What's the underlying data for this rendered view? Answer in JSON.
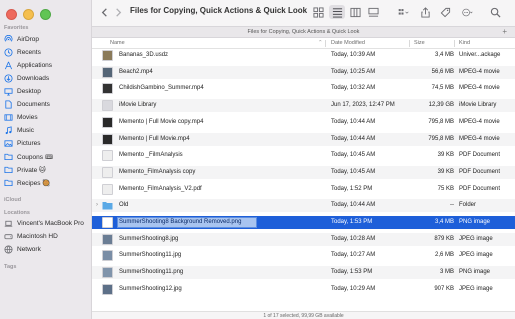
{
  "window": {
    "title": "Files for Copying, Quick Actions & Quick Look"
  },
  "tab": {
    "label": "Files for Copying, Quick Actions & Quick Look",
    "plus": "+"
  },
  "sidebar": {
    "favorites_heading": "Favorites",
    "favorites": [
      {
        "label": "AirDrop",
        "icon": "airdrop-icon"
      },
      {
        "label": "Recents",
        "icon": "clock-icon"
      },
      {
        "label": "Applications",
        "icon": "applications-icon"
      },
      {
        "label": "Downloads",
        "icon": "download-icon"
      },
      {
        "label": "Desktop",
        "icon": "desktop-icon"
      },
      {
        "label": "Documents",
        "icon": "document-icon"
      },
      {
        "label": "Movies",
        "icon": "film-icon"
      },
      {
        "label": "Music",
        "icon": "music-icon"
      },
      {
        "label": "Pictures",
        "icon": "picture-icon"
      },
      {
        "label": "Coupons 🎟",
        "icon": "folder-icon"
      },
      {
        "label": "Private 🐱",
        "icon": "folder-icon"
      },
      {
        "label": "Recipes 🥘",
        "icon": "folder-icon"
      }
    ],
    "icloud_heading": "iCloud",
    "locations_heading": "Locations",
    "locations": [
      {
        "label": "Vincent's MacBook Pro",
        "icon": "laptop-icon"
      },
      {
        "label": "Macintosh HD",
        "icon": "disk-icon"
      },
      {
        "label": "Network",
        "icon": "globe-icon"
      }
    ],
    "tags_heading": "Tags"
  },
  "columns": {
    "name": "Name",
    "date": "Date Modified",
    "size": "Size",
    "kind": "Kind"
  },
  "files": [
    {
      "name": "Bananas_3D.usdz",
      "date": "Today, 10:39 AM",
      "size": "3,4 MB",
      "kind": "Univer...ackage",
      "thumb": "#8a7a5a",
      "folder": false
    },
    {
      "name": "Beach2.mp4",
      "date": "Today, 10:25 AM",
      "size": "56,6 MB",
      "kind": "MPEG-4 movie",
      "thumb": "#556677",
      "folder": false
    },
    {
      "name": "ChildishGambino_Summer.mp4",
      "date": "Today, 10:32 AM",
      "size": "74,5 MB",
      "kind": "MPEG-4 movie",
      "thumb": "#333333",
      "folder": false
    },
    {
      "name": "iMovie Library",
      "date": "Jun 17, 2023, 12:47 PM",
      "size": "12,39 GB",
      "kind": "iMovie Library",
      "thumb": "#d9d9de",
      "folder": false
    },
    {
      "name": "Memento | Full Movie copy.mp4",
      "date": "Today, 10:44 AM",
      "size": "795,8 MB",
      "kind": "MPEG-4 movie",
      "thumb": "#2a2a2a",
      "folder": false
    },
    {
      "name": "Memento | Full Movie.mp4",
      "date": "Today, 10:44 AM",
      "size": "795,8 MB",
      "kind": "MPEG-4 movie",
      "thumb": "#2a2a2a",
      "folder": false
    },
    {
      "name": "Memento _FilmAnalysis",
      "date": "Today, 10:45 AM",
      "size": "39 KB",
      "kind": "PDF Document",
      "thumb": "#eeeeee",
      "folder": false
    },
    {
      "name": "Memento_FilmAnalysis copy",
      "date": "Today, 10:45 AM",
      "size": "39 KB",
      "kind": "PDF Document",
      "thumb": "#eeeeee",
      "folder": false
    },
    {
      "name": "Memento_FilmAnalysis_V2.pdf",
      "date": "Today, 1:52 PM",
      "size": "75 KB",
      "kind": "PDF Document",
      "thumb": "#eeeeee",
      "folder": false
    },
    {
      "name": "Old",
      "date": "Today, 10:44 AM",
      "size": "--",
      "kind": "Folder",
      "thumb": "#5aa9e6",
      "folder": true
    },
    {
      "name": "SummerShooting8 Background Removed.png",
      "date": "Today, 1:53 PM",
      "size": "3,4 MB",
      "kind": "PNG image",
      "thumb": "#ffffff",
      "folder": false,
      "selected": true
    },
    {
      "name": "SummerShooting8.jpg",
      "date": "Today, 10:28 AM",
      "size": "879 KB",
      "kind": "JPEG image",
      "thumb": "#6a7d94",
      "folder": false
    },
    {
      "name": "SummerShooting11.jpg",
      "date": "Today, 10:27 AM",
      "size": "2,6 MB",
      "kind": "JPEG image",
      "thumb": "#7a8ea6",
      "folder": false
    },
    {
      "name": "SummerShooting11.png",
      "date": "Today, 1:53 PM",
      "size": "3 MB",
      "kind": "PNG image",
      "thumb": "#8094ab",
      "folder": false
    },
    {
      "name": "SummerShooting12.jpg",
      "date": "Today, 10:29 AM",
      "size": "907 KB",
      "kind": "JPEG image",
      "thumb": "#5d7088",
      "folder": false
    }
  ],
  "status": {
    "text": "1 of 17 selected, 99,99 GB available"
  },
  "colors": {
    "selection": "#1e5fd9",
    "sidebar_bg": "#ebe8ec",
    "accent_icon": "#1a73e8"
  }
}
